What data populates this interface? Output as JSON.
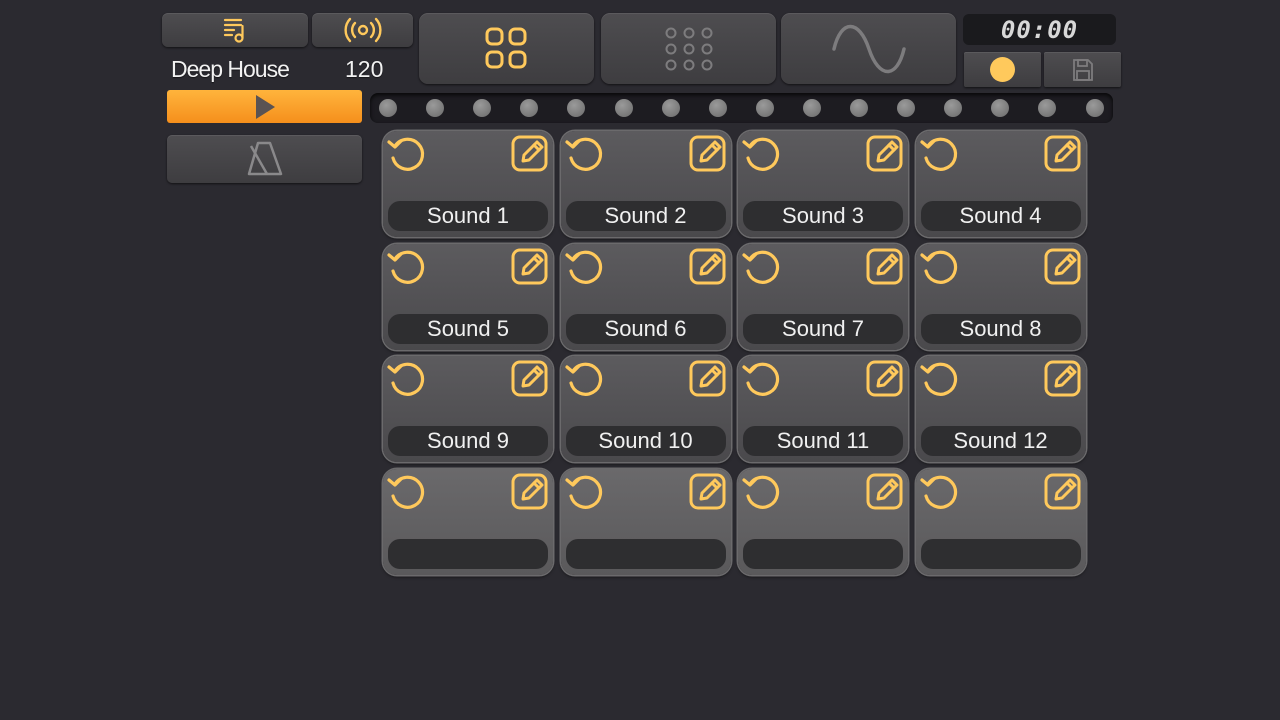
{
  "project": {
    "name": "Deep House",
    "bpm": "120"
  },
  "timer": "00:00",
  "colors": {
    "accent": "#ffc95c",
    "play": "#f79a22"
  },
  "icons": {
    "playlist": "music-list-icon",
    "broadcast": "broadcast-icon",
    "pads_view": "grid-four-icon",
    "sequencer_view": "grid-nine-icon",
    "synth_view": "sine-wave-icon",
    "record": "record-dot-icon",
    "save": "floppy-disk-icon",
    "metronome": "metronome-icon"
  },
  "steps": 16,
  "pads": [
    {
      "label": "Sound 1"
    },
    {
      "label": "Sound 2"
    },
    {
      "label": "Sound 3"
    },
    {
      "label": "Sound 4"
    },
    {
      "label": "Sound 5"
    },
    {
      "label": "Sound 6"
    },
    {
      "label": "Sound 7"
    },
    {
      "label": "Sound 8"
    },
    {
      "label": "Sound 9"
    },
    {
      "label": "Sound 10"
    },
    {
      "label": "Sound 11"
    },
    {
      "label": "Sound 12"
    },
    {
      "label": ""
    },
    {
      "label": ""
    },
    {
      "label": ""
    },
    {
      "label": ""
    }
  ]
}
